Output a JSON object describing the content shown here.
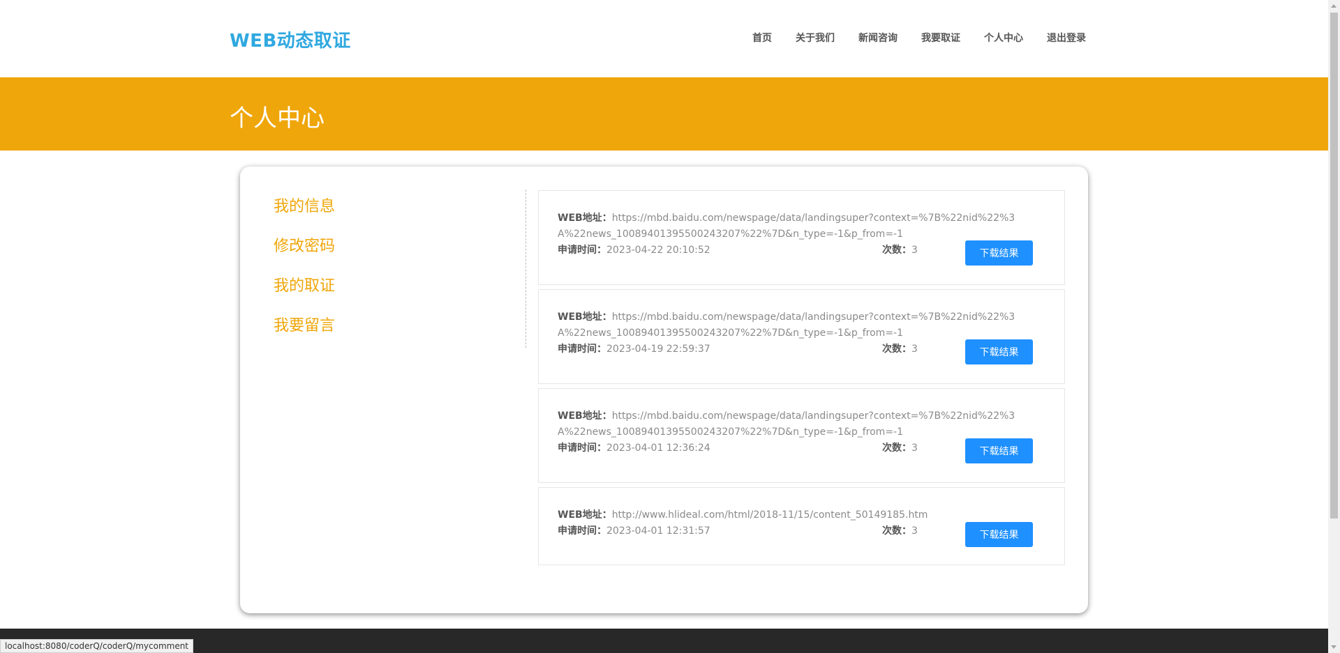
{
  "header": {
    "brand": "WEB动态取证",
    "nav": [
      "首页",
      "关于我们",
      "新闻咨询",
      "我要取证",
      "个人中心",
      "退出登录"
    ]
  },
  "banner": {
    "title": "个人中心"
  },
  "sidebar": {
    "items": [
      "我的信息",
      "修改密码",
      "我的取证",
      "我要留言"
    ]
  },
  "labels": {
    "url": "WEB地址：",
    "time": "申请时间：",
    "count": "次数：",
    "download": "下载结果"
  },
  "records": [
    {
      "url": "https://mbd.baidu.com/newspage/data/landingsuper?context=%7B%22nid%22%3A%22news_10089401395500243207%22%7D&n_type=-1&p_from=-1",
      "time": "2023-04-22 20:10:52",
      "count": "3"
    },
    {
      "url": "https://mbd.baidu.com/newspage/data/landingsuper?context=%7B%22nid%22%3A%22news_10089401395500243207%22%7D&n_type=-1&p_from=-1",
      "time": "2023-04-19 22:59:37",
      "count": "3"
    },
    {
      "url": "https://mbd.baidu.com/newspage/data/landingsuper?context=%7B%22nid%22%3A%22news_10089401395500243207%22%7D&n_type=-1&p_from=-1",
      "time": "2023-04-01 12:36:24",
      "count": "3"
    },
    {
      "url": "http://www.hlideal.com/html/2018-11/15/content_50149185.htm",
      "time": "2023-04-01 12:31:57",
      "count": "3"
    }
  ],
  "status_bar": {
    "url": "localhost:8080/coderQ/coderQ/mycomment"
  },
  "colors": {
    "brand": "#2fa8e0",
    "banner": "#efa60a",
    "sidebar_link": "#efa60a",
    "button": "#1e90ff",
    "footer": "#282828"
  }
}
